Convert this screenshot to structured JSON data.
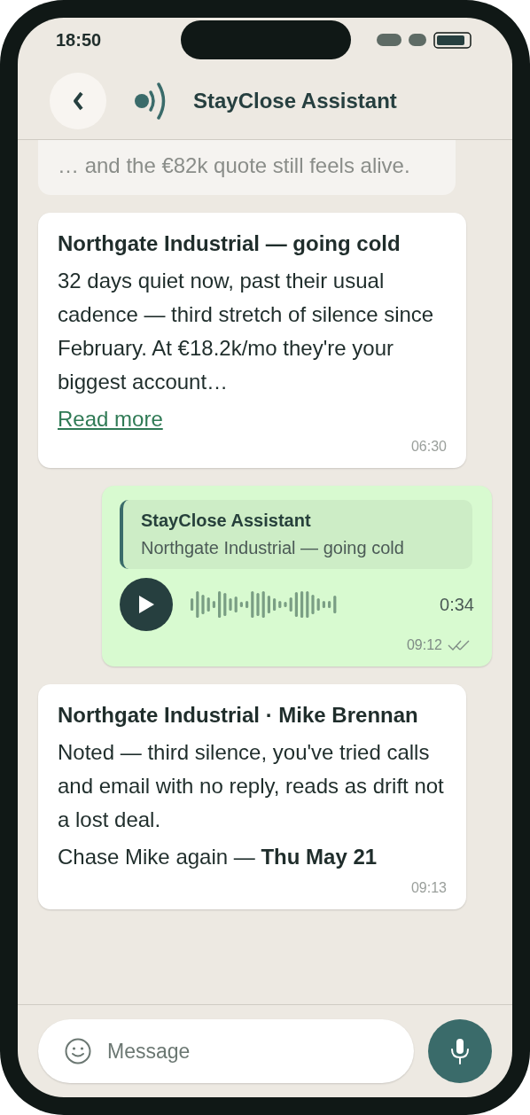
{
  "status_bar": {
    "time": "18:50"
  },
  "header": {
    "title": "StayClose Assistant"
  },
  "messages": [
    {
      "kind": "faded",
      "text": "… and the €82k quote still feels alive."
    },
    {
      "kind": "incoming",
      "title": "Northgate Industrial — going cold",
      "body": [
        "32 days quiet now, past their usual cadence — third stretch of silence since February. At €18.2k/mo they're your biggest account…"
      ],
      "link": "Read more",
      "time": "06:30"
    },
    {
      "kind": "voice",
      "quote": {
        "author": "StayClose Assistant",
        "text": "Northgate Industrial — going cold"
      },
      "duration": "0:34",
      "time": "09:12",
      "read": true
    },
    {
      "kind": "incoming",
      "title": "Northgate Industrial · Mike Brennan",
      "body": [
        "Noted — third silence, you've tried calls and email with no reply, reads as drift not a lost deal.",
        "Chase Mike again — **Thu May 21**"
      ],
      "time": "09:13"
    }
  ],
  "composer": {
    "placeholder": "Message"
  }
}
